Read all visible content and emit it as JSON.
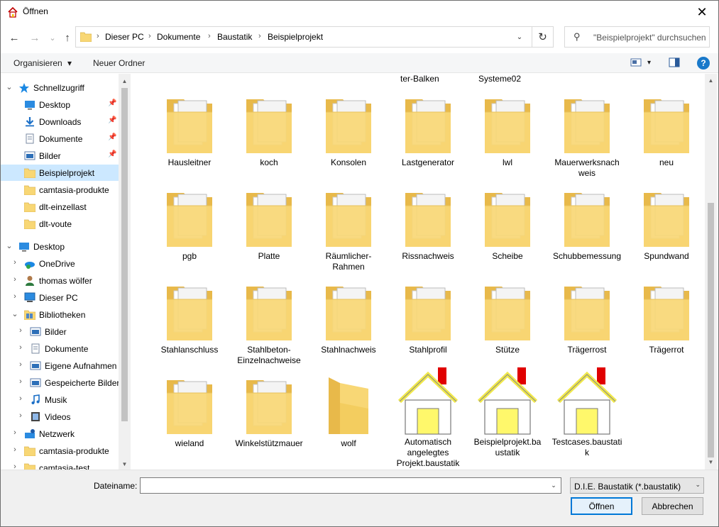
{
  "window": {
    "title": "Öffnen",
    "close_glyph": "✕"
  },
  "nav": {
    "back_glyph": "←",
    "forward_glyph": "→",
    "recent_glyph": "⌄",
    "up_glyph": "↑",
    "crumbs": [
      "Dieser PC",
      "Dokumente",
      "Baustatik",
      "Beispielprojekt"
    ],
    "crumb_sep": "›",
    "dropdown_glyph": "⌄",
    "refresh_glyph": "↻"
  },
  "search": {
    "placeholder": "\"Beispielprojekt\" durchsuchen",
    "icon_glyph": "⚲"
  },
  "toolbar": {
    "organize_label": "Organisieren",
    "organize_arrow": "▾",
    "new_folder_label": "Neuer Ordner",
    "view_arrow": "▾",
    "help_glyph": "?"
  },
  "sidebar": {
    "items": [
      {
        "label": "Schnellzugriff",
        "chev": "⌄",
        "icon": "star-icon"
      },
      {
        "label": "Desktop",
        "pin": "📌",
        "icon": "desktop-icon"
      },
      {
        "label": "Downloads",
        "pin": "📌",
        "icon": "download-icon"
      },
      {
        "label": "Dokumente",
        "pin": "📌",
        "icon": "documents-icon"
      },
      {
        "label": "Bilder",
        "pin": "📌",
        "icon": "pictures-icon"
      },
      {
        "label": "Beispielprojekt",
        "icon": "folder-icon"
      },
      {
        "label": "camtasia-produkte",
        "icon": "folder-icon"
      },
      {
        "label": "dlt-einzellast",
        "icon": "folder-icon"
      },
      {
        "label": "dlt-voute",
        "icon": "folder-icon"
      },
      {
        "label": "Desktop",
        "chev": "⌄",
        "icon": "desktop-icon"
      },
      {
        "label": "OneDrive",
        "chev": "›",
        "icon": "onedrive-icon"
      },
      {
        "label": "thomas wölfer",
        "chev": "›",
        "icon": "user-icon"
      },
      {
        "label": "Dieser PC",
        "chev": "›",
        "icon": "pc-icon"
      },
      {
        "label": "Bibliotheken",
        "chev": "⌄",
        "icon": "libraries-icon"
      },
      {
        "label": "Bilder",
        "chev": "›",
        "icon": "pictures-icon"
      },
      {
        "label": "Dokumente",
        "chev": "›",
        "icon": "documents-icon"
      },
      {
        "label": "Eigene Aufnahmen",
        "chev": "›",
        "icon": "pictures-icon"
      },
      {
        "label": "Gespeicherte Bilder",
        "chev": "›",
        "icon": "pictures-icon"
      },
      {
        "label": "Musik",
        "chev": "›",
        "icon": "music-icon"
      },
      {
        "label": "Videos",
        "chev": "›",
        "icon": "video-icon"
      },
      {
        "label": "Netzwerk",
        "chev": "›",
        "icon": "network-icon"
      },
      {
        "label": "camtasia-produkte",
        "chev": "›",
        "icon": "folder-icon"
      },
      {
        "label": "camtasia-test",
        "chev": "›",
        "icon": "folder-icon"
      }
    ],
    "scroll_up": "▲",
    "scroll_down": "▼"
  },
  "content": {
    "partial_labels": [
      "ter-Balken",
      "Systeme02"
    ],
    "items": [
      {
        "name": "Hausleitner",
        "type": "folder"
      },
      {
        "name": "koch",
        "type": "folder"
      },
      {
        "name": "Konsolen",
        "type": "folder"
      },
      {
        "name": "Lastgenerator",
        "type": "folder"
      },
      {
        "name": "lwl",
        "type": "folder"
      },
      {
        "name": "Mauerwerksnachweis",
        "type": "folder"
      },
      {
        "name": "neu",
        "type": "folder"
      },
      {
        "name": "pgb",
        "type": "folder"
      },
      {
        "name": "Platte",
        "type": "folder"
      },
      {
        "name": "Räumlicher-Rahmen",
        "type": "folder"
      },
      {
        "name": "Rissnachweis",
        "type": "folder"
      },
      {
        "name": "Scheibe",
        "type": "folder"
      },
      {
        "name": "Schubbemessung",
        "type": "folder"
      },
      {
        "name": "Spundwand",
        "type": "folder"
      },
      {
        "name": "Stahlanschluss",
        "type": "folder"
      },
      {
        "name": "Stahlbeton-Einzelnachweise",
        "type": "folder"
      },
      {
        "name": "Stahlnachweis",
        "type": "folder"
      },
      {
        "name": "Stahlprofil",
        "type": "folder"
      },
      {
        "name": "Stütze",
        "type": "folder"
      },
      {
        "name": "Trägerrost",
        "type": "folder"
      },
      {
        "name": "Trägerrot",
        "type": "folder"
      },
      {
        "name": "wieland",
        "type": "folder"
      },
      {
        "name": "Winkelstützmauer",
        "type": "folder"
      },
      {
        "name": "wolf",
        "type": "folder"
      },
      {
        "name": "Automatisch angelegtes Projekt.baustatik",
        "type": "file"
      },
      {
        "name": "Beispielprojekt.baustatik",
        "type": "file"
      },
      {
        "name": "Testcases.baustatik",
        "type": "file"
      }
    ],
    "scroll_up": "▲",
    "scroll_down": "▼"
  },
  "footer": {
    "filename_label": "Dateiname:",
    "filename_value": "",
    "filename_dd": "⌄",
    "filetype_value": "D.I.E. Baustatik (*.baustatik)",
    "filetype_dd": "⌄",
    "open_label": "Öffnen",
    "cancel_label": "Abbrechen"
  },
  "colors": {
    "accent": "#0078d7",
    "selection": "#cce8ff",
    "folder": "#f8d775",
    "house_wall": "#fff86b",
    "chimney": "#e00000"
  }
}
